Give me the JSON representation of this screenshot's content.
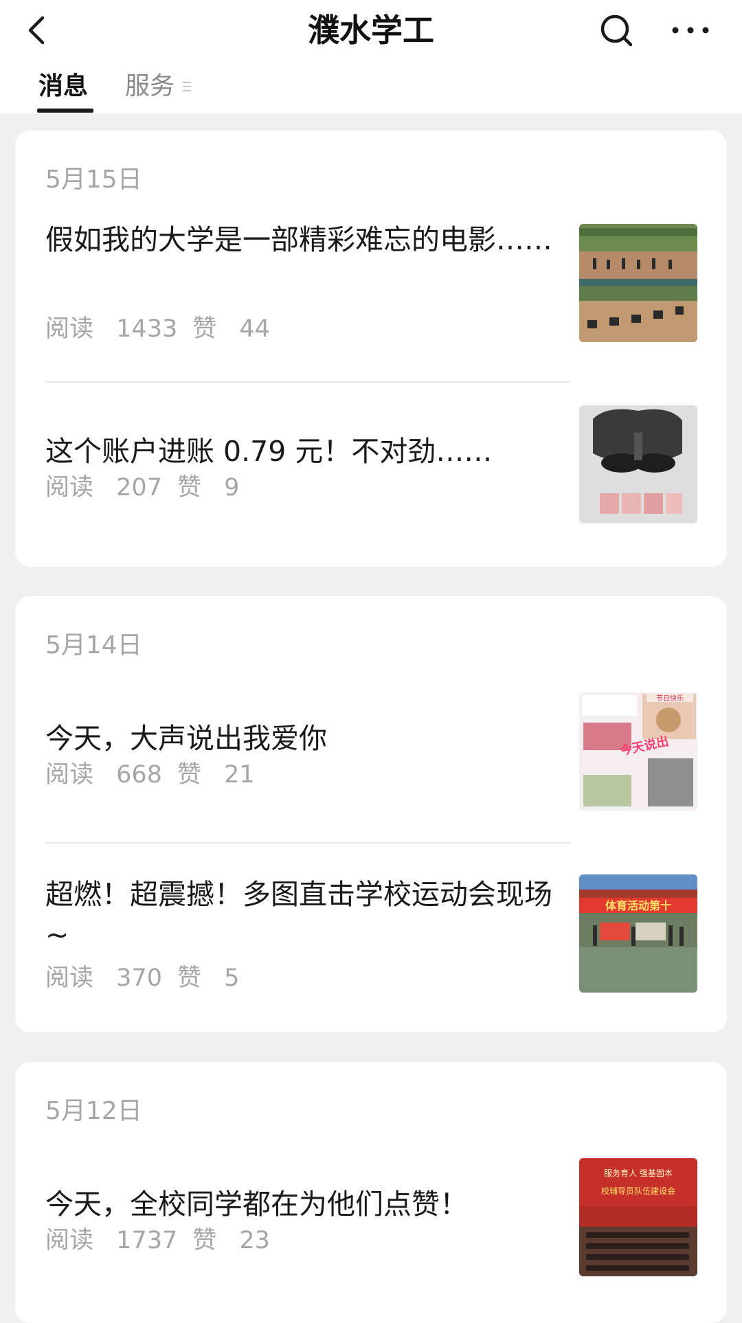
{
  "header": {
    "title": "濮水学工",
    "tabs": [
      {
        "label": "消息",
        "active": true
      },
      {
        "label": "服务",
        "active": false
      }
    ]
  },
  "groups": [
    {
      "date": "5月15日",
      "articles": [
        {
          "title": "假如我的大学是一部精彩难忘的电影……",
          "read_label": "阅读",
          "reads": "1433",
          "like_label": "赞",
          "likes": "44"
        },
        {
          "title": "这个账户进账 0.79 元！不对劲……",
          "read_label": "阅读",
          "reads": "207",
          "like_label": "赞",
          "likes": "9"
        }
      ]
    },
    {
      "date": "5月14日",
      "articles": [
        {
          "title": "今天，大声说出我爱你",
          "read_label": "阅读",
          "reads": "668",
          "like_label": "赞",
          "likes": "21"
        },
        {
          "title": "超燃！超震撼！多图直击学校运动会现场 ~",
          "read_label": "阅读",
          "reads": "370",
          "like_label": "赞",
          "likes": "5"
        }
      ]
    },
    {
      "date": "5月12日",
      "articles": [
        {
          "title": "今天，全校同学都在为他们点赞！",
          "read_label": "阅读",
          "reads": "1737",
          "like_label": "赞",
          "likes": "23"
        }
      ]
    }
  ],
  "thumb_text": {
    "t3_banner": "节日快乐",
    "t3_overlay": "今天说出",
    "t4_banner": "体育活动第十",
    "t5_banner": "服务育人 强基固本",
    "t5_sub": "校辅导员队伍建设会"
  },
  "colors": {
    "background": "#f0f0f0",
    "card": "#ffffff",
    "text": "#1a1a1a",
    "meta": "#a6a6a6"
  },
  "icons": [
    "back-arrow-icon",
    "search-icon",
    "more-icon",
    "tab-menu-icon"
  ]
}
